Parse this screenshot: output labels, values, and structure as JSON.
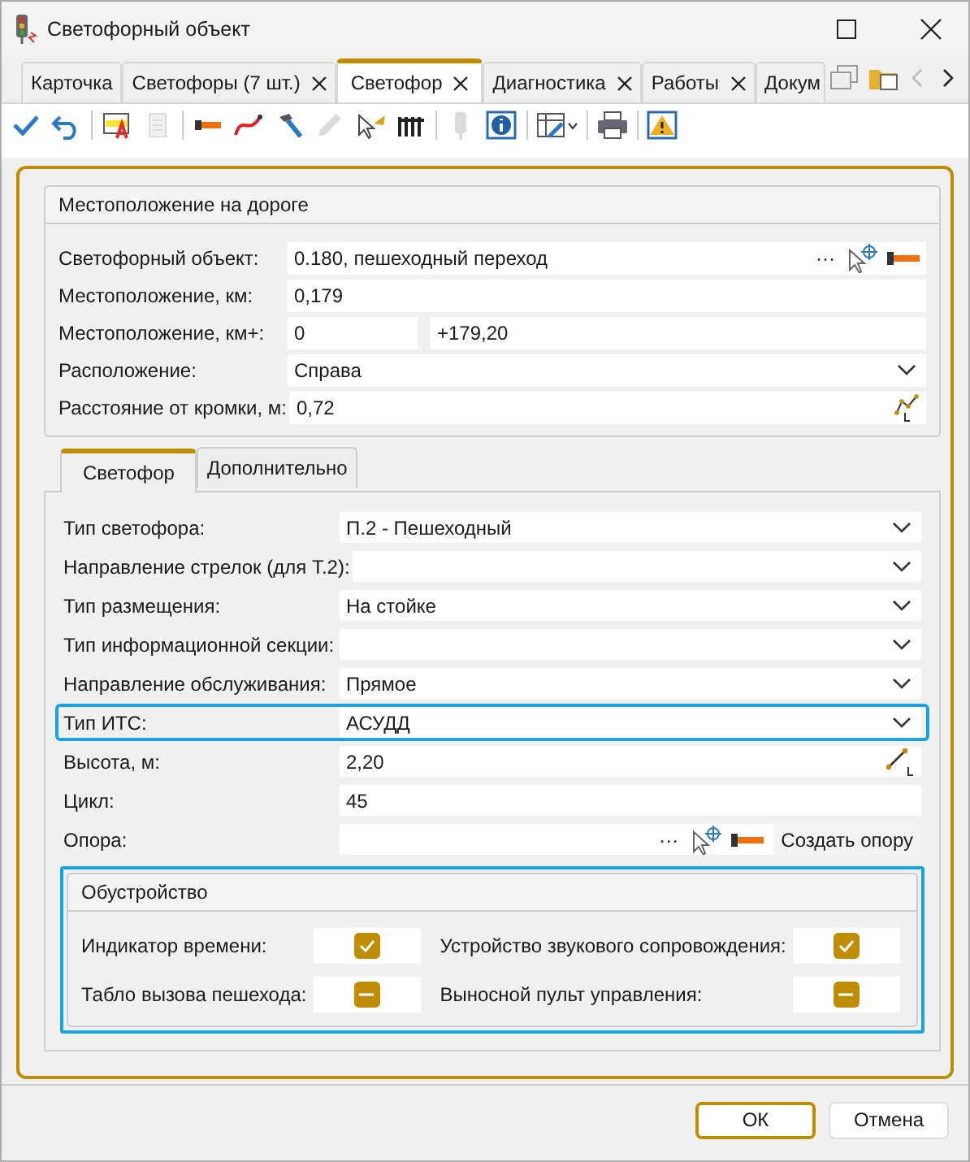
{
  "window": {
    "title": "Светофорный объект"
  },
  "tabs": [
    {
      "label": "Карточка",
      "closable": false,
      "selected": false
    },
    {
      "label": "Светофоры (7 шт.)",
      "closable": true,
      "selected": false
    },
    {
      "label": "Светофор",
      "closable": true,
      "selected": true
    },
    {
      "label": "Диагностика",
      "closable": true,
      "selected": false
    },
    {
      "label": "Работы",
      "closable": true,
      "selected": false
    },
    {
      "label": "Докум",
      "closable": false,
      "selected": false
    }
  ],
  "toolbar": [
    {
      "kind": "check",
      "disabled": false
    },
    {
      "kind": "undo",
      "disabled": false
    },
    {
      "kind": "sep"
    },
    {
      "kind": "table-edit",
      "disabled": false
    },
    {
      "kind": "doc",
      "disabled": true
    },
    {
      "kind": "sep"
    },
    {
      "kind": "flashlight",
      "disabled": false
    },
    {
      "kind": "curve",
      "disabled": false
    },
    {
      "kind": "hammer",
      "disabled": false
    },
    {
      "kind": "pencil",
      "disabled": true
    },
    {
      "kind": "pointer",
      "disabled": false
    },
    {
      "kind": "fence",
      "disabled": false
    },
    {
      "kind": "sep"
    },
    {
      "kind": "traffic",
      "disabled": true
    },
    {
      "kind": "info",
      "disabled": false
    },
    {
      "kind": "sep"
    },
    {
      "kind": "grid-edit",
      "disabled": false
    },
    {
      "kind": "sep"
    },
    {
      "kind": "printer",
      "disabled": false
    },
    {
      "kind": "sep"
    },
    {
      "kind": "warning",
      "disabled": false
    }
  ],
  "location": {
    "title": "Местоположение на дороге",
    "rows": [
      {
        "kind": "picker",
        "label": "Светофорный объект:",
        "value": "0.180, пешеходный переход",
        "dots": "···"
      },
      {
        "kind": "text",
        "label": "Местоположение, км:",
        "value": "0,179"
      },
      {
        "kind": "split",
        "label": "Местоположение, км+:",
        "value": "0",
        "value2": "+179,20"
      },
      {
        "kind": "dropdown",
        "label": "Расположение:",
        "value": "Справа"
      },
      {
        "kind": "measure-curve",
        "label": "Расстояние от кромки, м:",
        "value": "0,72"
      }
    ]
  },
  "subtabs": [
    {
      "label": "Светофор",
      "selected": true
    },
    {
      "label": "Дополнительно",
      "selected": false
    }
  ],
  "fields": [
    {
      "kind": "dropdown",
      "label": "Тип светофора:",
      "value": "П.2 - Пешеходный",
      "focused": false
    },
    {
      "kind": "dropdown",
      "label": "Направление стрелок (для Т.2):",
      "focused": false
    },
    {
      "kind": "dropdown",
      "label": "Тип размещения:",
      "value": "На стойке",
      "focused": false
    },
    {
      "kind": "dropdown",
      "label": "Тип информационной секции:",
      "focused": false
    },
    {
      "kind": "dropdown",
      "label": "Направление обслуживания:",
      "value": "Прямое",
      "focused": false
    },
    {
      "kind": "dropdown",
      "label": "Тип ИТС:",
      "value": "АСУДД",
      "focused": true
    },
    {
      "kind": "measure-line",
      "label": "Высота, м:",
      "value": "2,20",
      "focused": false
    },
    {
      "kind": "text",
      "label": "Цикл:",
      "value": "45",
      "focused": false
    },
    {
      "kind": "picker",
      "label": "Опора:",
      "dots": "···",
      "button": "Создать опору",
      "focused": false
    }
  ],
  "equipment": {
    "title": "Обустройство",
    "focused": true,
    "items": [
      {
        "label": "Индикатор времени:",
        "checked": true
      },
      {
        "label": "Устройство звукового сопровождения:",
        "checked": true
      },
      {
        "label": "Табло вызова пешехода:",
        "checked": false,
        "indeterminate": true
      },
      {
        "label": "Выносной пульт управления:",
        "checked": false,
        "indeterminate": true
      }
    ]
  },
  "buttons": [
    {
      "label": "ОК",
      "default": true
    },
    {
      "label": "Отмена",
      "default": false
    }
  ]
}
